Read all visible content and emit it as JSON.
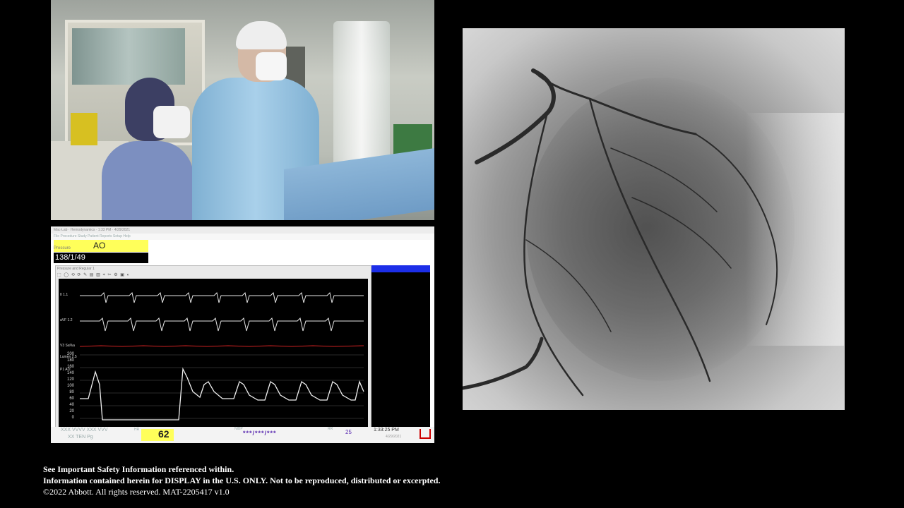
{
  "monitor": {
    "title_bar": "Mac-Lab · Hemodynamics · 1:33 PM · 4/29/2021",
    "menu_bar": "File   Procedure   Study   Patient   Reports   Setup   Help",
    "ao_field_label": "Pressure",
    "ao_label": "AO",
    "ao_value": "138/1/49",
    "waveform_window_title": "Pressure and Regular 1",
    "toolbar_glyphs": "⬚ ◯ ⟲ ⟳ ✎ ▤ ▥ ⌖ ✂ ⚙ ▣ ◐",
    "leads": [
      "II  1.1",
      "aVF  1.2",
      "V3 Sa%a",
      "Lumen 2.5",
      "P1 AO"
    ],
    "pressure_scale": [
      "200",
      "180",
      "160",
      "140",
      "120",
      "100",
      "80",
      "60",
      "40",
      "20",
      "0"
    ],
    "status": {
      "left_top": "XXX VVVV   XXX VVV",
      "left_bottom": "XX   TEN Pg",
      "hr_label": "HR",
      "hr_value": "62",
      "bp_label": "NIBP",
      "bp_value": "***/***/***",
      "resp_label": "RR",
      "resp_value": "25",
      "time": "1:33:25 PM",
      "date": "4/29/2021"
    }
  },
  "footer": {
    "line1": "See Important Safety Information referenced within.",
    "line2": "Information contained herein for DISPLAY in the U.S. ONLY. Not to be reproduced, distributed or excerpted.",
    "line3": "©2022 Abbott. All rights reserved. MAT-2205417 v1.0"
  },
  "colors": {
    "ecg_trace": "#e6e6e6",
    "spo2_trace": "#d22222",
    "pressure_trace": "#f0f0f0",
    "highlight_yellow": "#ffff5a",
    "accent_blue": "#1c2ee8"
  }
}
